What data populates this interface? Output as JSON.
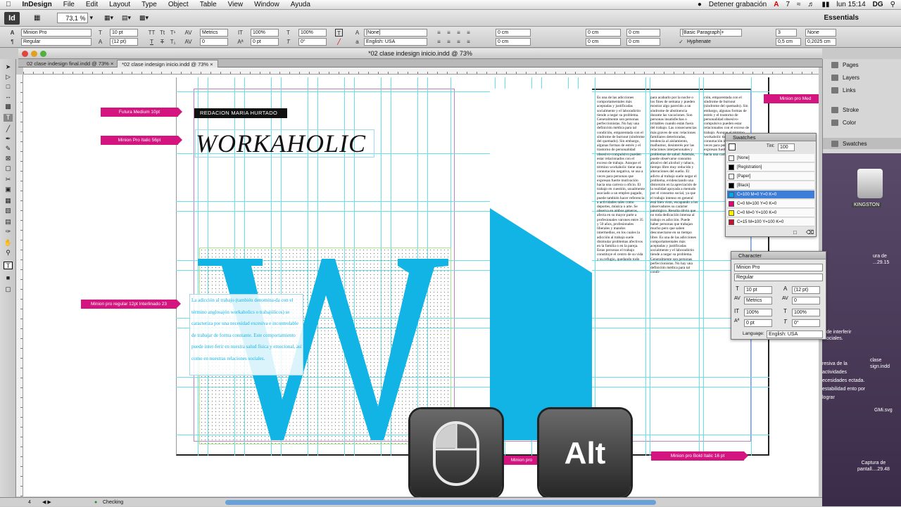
{
  "menubar": {
    "apple": "",
    "items": [
      "InDesign",
      "File",
      "Edit",
      "Layout",
      "Type",
      "Object",
      "Table",
      "View",
      "Window",
      "Ayuda"
    ],
    "status": "Detener grabación",
    "adobe": "7",
    "clock": "lun 15:14",
    "user": "DG"
  },
  "approw": {
    "logo": "Id",
    "zoom": "73,1 %",
    "workspace": "Essentials"
  },
  "control": {
    "font_family": "Minion Pro",
    "font_style": "Regular",
    "font_size": "10 pt",
    "leading": "(12 pt)",
    "kerning": "Metrics",
    "tracking": "0",
    "scale_v": "100%",
    "scale_h": "100%",
    "baseline": "0 pt",
    "skew": "0°",
    "char_style": "[None]",
    "language": "English: USA",
    "indent_left": "0 cm",
    "indent_right": "0 cm",
    "indent_first": "0 cm",
    "indent_last": "0 cm",
    "space_before": "0 cm",
    "space_after": "0 cm",
    "para_style": "[Basic Paragraph]+",
    "hyphenate": "Hyphenate",
    "columns": "3",
    "col_gutter": "0,5 cm",
    "drop_none": "None",
    "col_value": "0,2025 cm"
  },
  "document": {
    "window_title": "*02 clase indesign inicio.indd @ 73%",
    "tabs": [
      "02 clase indesign final.indd @ 73%",
      "*02 clase indesign inicio.indd @ 73%"
    ]
  },
  "layout": {
    "byline": "REDACION MARIA HURTADO",
    "headline": "WORKAHOLIC",
    "intro": "La adicción al trabajo (también denomina-da con el término anglosajón workaholics o trabajólicos) se caracteriza por una necesidad excesiva e incontrolable de trabajar de forma constante. Este comportamiento puede inter-ferir en nuestra salud física y emocional, así como en nuestras relaciones sociales.",
    "notes": [
      "Futura Medium 10pt",
      "Minion Pro Italic 56pt",
      "Minion pro regular 12pt Interlinado 23",
      "Minion pro Med",
      "Minion pro Bold Italic 16 pt",
      "Minion pro"
    ],
    "col1": "Es una de las adicciones comportamentales más aceptadas y justificadas socialmente y el laboradictio tiende a negar su problema. Generalmente son personas perfeccionistas. No hay una definición médica para tal condición, emparentada con el síndrome de burnout (síndrome del quemado). Sin embargo, algunas formas de estrés y el trastorno de personalidad obsesivo-compulsivo pueden estar relacionados con el exceso de trabajo. Aunque el término workaholic tiene una connotación negativa, se usa a veces para personas que expresan fuerte motivación hacia una carrera u oficio. El trabajo en cuestión, usualmente asociado a un empleo pagado, puede también hacer referencia a actividades tales como deportes, música o arte. Se observa en ambos géneros, afecta en su mayor parte a profesionales varones entre 35 y 50 años, profesionales liberales y mandos intermedios, en los cuales la adicción al trabajo suele disimular problemas afectivos en la familia o en la pareja. Estas personas el trabajo constituye el centro de su vida y su refugio, quedando todo",
    "col2": "para acabarlo por la noche o los fines de semana y pueden mostrar algo parecido a un síndrome de abstinencia durante las vacaciones. Son personas insatisfechas o irritables cuando están fuera del trabajo. Las consecuencias más graves de son: relaciones familiares deterioradas, tendencia al aislamiento, malhumor, desinterés por las relaciones interpersonales y problemas de salud. Además, puede observarse consumo abusivo del alcohol y tabaco, tiempo libre muy reducido y alteraciones del sueño. El adicto al trabajo suele negar el problema, evidenciando una distorsión en la apreciación de la realidad apoyada a menudo por el consumo social, ya que el trabajo intenso en general está bien visto, escapando a los observadores su carácter patológico. Resulta obvio que no toda dedicación intensa al trabajo es adicción. Puede haber personas que trabajan mucho pero que saben desconectarse en su tiempo libre. Es una de las adicciones comportamentales más aceptadas y justificadas socialmente y el laboradictio tiende a negar su problema. Generalmente son personas perfeccionistas. No hay una definición médica para tal condi-",
    "col3": "ción, emparentada con el síndrome de burnout (síndrome del quemado). Sin embargo, algunas formas de estrés y el trastorno de personalidad obsesivo-compulsivo pueden estar relacionados con el exceso de trabajo. Aunque el término workaholic tiene una connotación negativa, se usa a veces para personas que expresan fuerte motivación hacia una carrera u oficio."
  },
  "panels": {
    "right": [
      "Pages",
      "Layers",
      "Links",
      "Stroke",
      "Color",
      "Swatches"
    ],
    "swatches": {
      "title": "Swatches",
      "tint_label": "Tint:",
      "tint": "100",
      "rows": [
        {
          "name": "[None]",
          "color": "#ffffff"
        },
        {
          "name": "[Registration]",
          "color": "#000000"
        },
        {
          "name": "[Paper]",
          "color": "#ffffff"
        },
        {
          "name": "[Black]",
          "color": "#000000"
        },
        {
          "name": "C=100 M=0 Y=0 K=0",
          "color": "#00a8e8"
        },
        {
          "name": "C=0 M=100 Y=0 K=0",
          "color": "#e6007e"
        },
        {
          "name": "C=0 M=0 Y=100 K=0",
          "color": "#fff200"
        },
        {
          "name": "C=15 M=100 Y=100 K=0",
          "color": "#c8102e"
        }
      ]
    },
    "character": {
      "title": "Character",
      "font": "Minion Pro",
      "style": "Regular",
      "size": "10 pt",
      "leading": "(12 pt)",
      "kerning": "Metrics",
      "tracking": "0",
      "scale_v": "100%",
      "scale_h": "100%",
      "baseline": "0 pt",
      "skew": "0°",
      "language_label": "Language:",
      "language": "English: USA"
    }
  },
  "desktop": {
    "drive": "KINGSTON",
    "captura1": "ura de",
    "captura1b": "...29.15",
    "snippet": "de interferir ociales.",
    "snippet2": "resiva de la actividades ecesidades ectada. estabilidad ento por lograr",
    "file1": "clase",
    "file1b": "sign.indd",
    "file2": "GMi.svg",
    "captura2": "Captura de",
    "captura2b": "pantall....29.48"
  },
  "keys": {
    "alt": "Alt"
  },
  "status": {
    "page": "4",
    "preflight": "Checking"
  },
  "colors": {
    "accent_cyan": "#12b4e6",
    "note_magenta": "#d4157f",
    "guide_cyan": "#66e0ea"
  }
}
